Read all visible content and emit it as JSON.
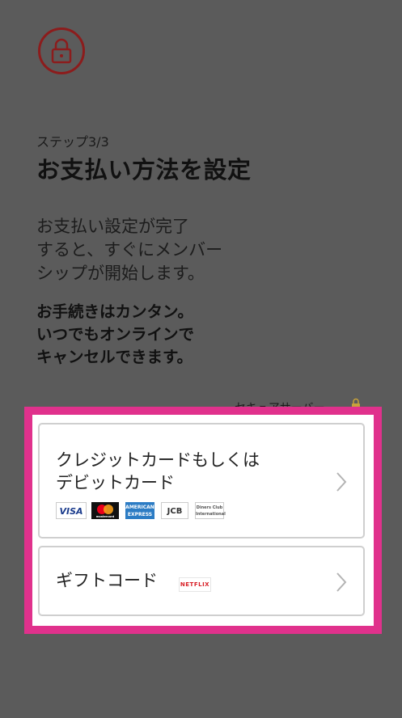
{
  "header": {
    "lock_icon": "lock-icon",
    "step": "ステップ3/3",
    "title": "お支払い方法を設定"
  },
  "description": {
    "lines": [
      "お支払い設定が完了",
      "すると、すぐにメンバー",
      "シップが開始します。"
    ]
  },
  "note": {
    "lines": [
      "お手続きはカンタン。",
      "いつでもオンラインで",
      "キャンセルできます。"
    ]
  },
  "secure_label": "セキュアサーバー",
  "options": {
    "card": {
      "label_lines": [
        "クレジットカードもしくは",
        "デビットカード"
      ],
      "logos": {
        "visa": "VISA",
        "mastercard": "mastercard",
        "amex": "AMERICAN EXPRESS",
        "jcb": "JCB",
        "diners": "Diners Club International"
      }
    },
    "gift": {
      "label": "ギフトコード",
      "logo": "NETFLIX"
    }
  },
  "colors": {
    "accent_highlight": "#e0318c",
    "lock_red": "#8c1c1c",
    "netflix_red": "#d81f26"
  }
}
